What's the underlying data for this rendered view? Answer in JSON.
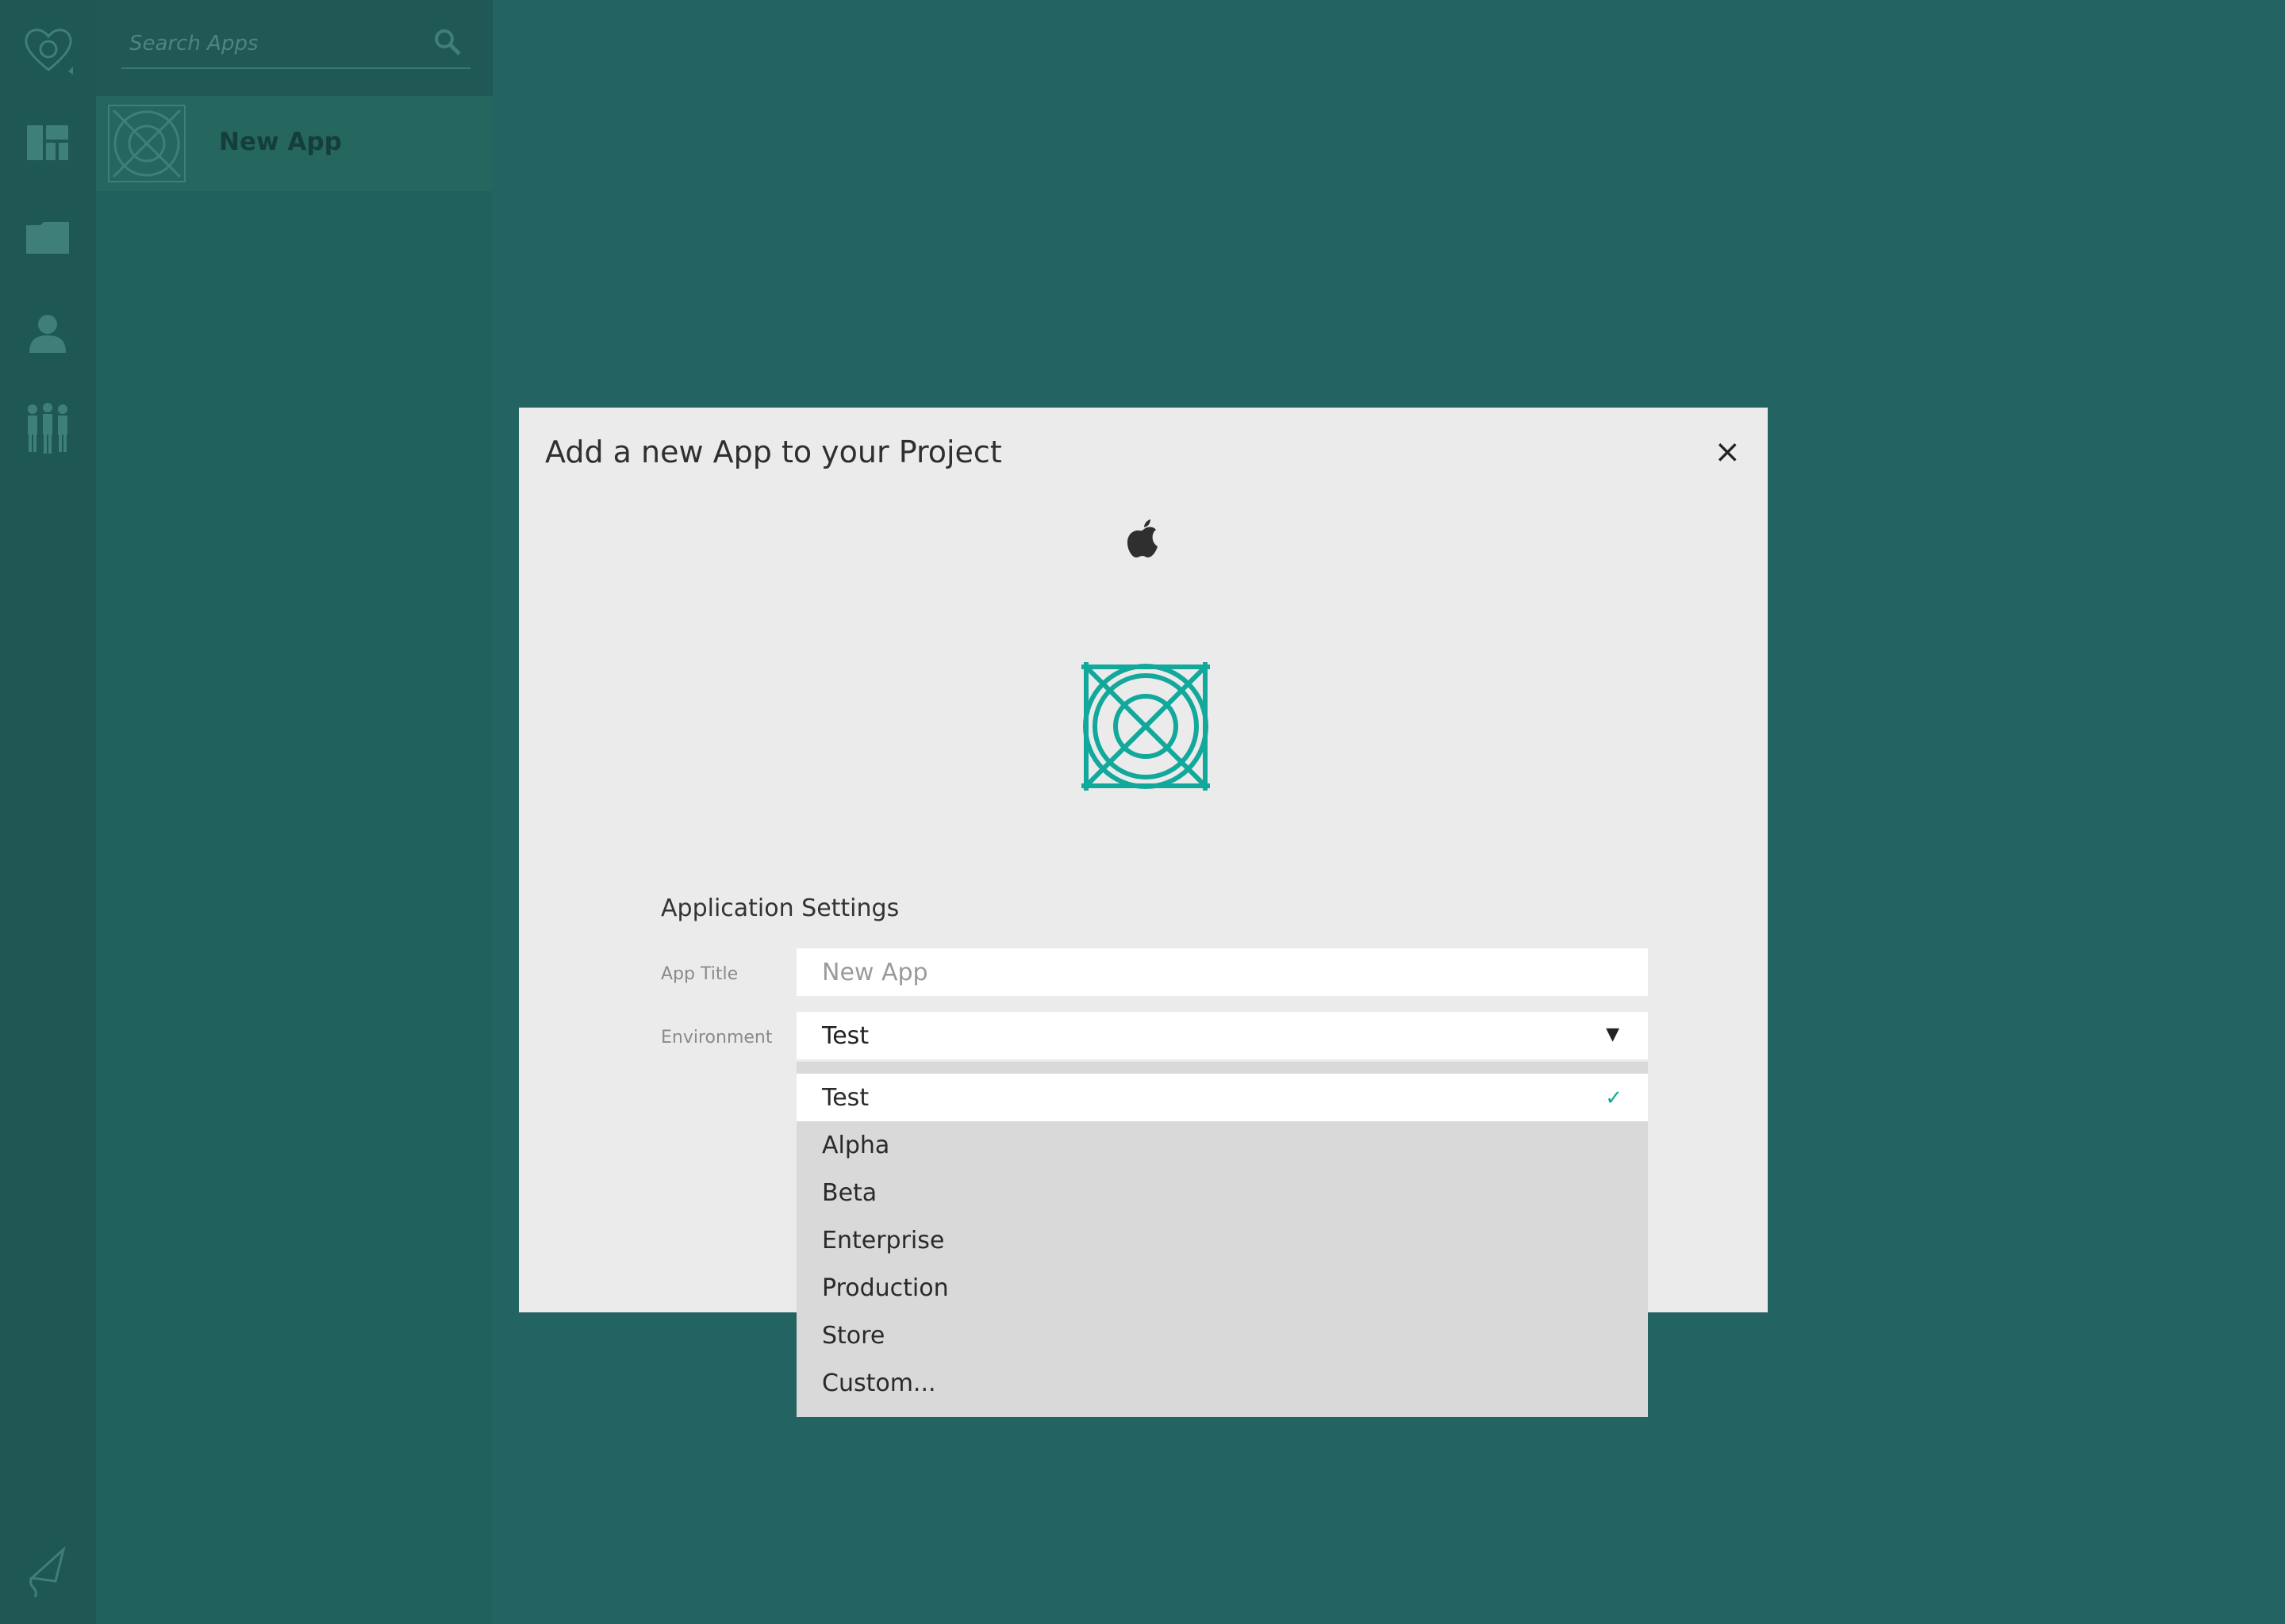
{
  "sidebar": {
    "search_placeholder": "Search Apps",
    "apps": [
      {
        "label": "New App"
      }
    ],
    "nav_icons": [
      "dashboard-icon",
      "folder-icon",
      "user-icon",
      "team-icon"
    ],
    "bottom_icon": "kite-icon",
    "logo_icon": "heart-logo-icon"
  },
  "modal": {
    "title": "Add a new App to your Project",
    "close_label": "×",
    "platform_icon": "apple-icon",
    "section_heading": "Application Settings",
    "fields": {
      "app_title": {
        "label": "App Title",
        "placeholder": "New App",
        "value": ""
      },
      "environment": {
        "label": "Environment",
        "value": "Test"
      }
    }
  },
  "dropdown": {
    "selected": "Test",
    "options": [
      "Test",
      "Alpha",
      "Beta",
      "Enterprise",
      "Production",
      "Store",
      "Custom..."
    ],
    "check_glyph": "✓",
    "arrow_glyph": "▼"
  },
  "colors": {
    "accent": "#12a89b",
    "backdrop": "#236462",
    "nav_rail": "#1e5754",
    "modal_bg": "#ebebeb"
  }
}
